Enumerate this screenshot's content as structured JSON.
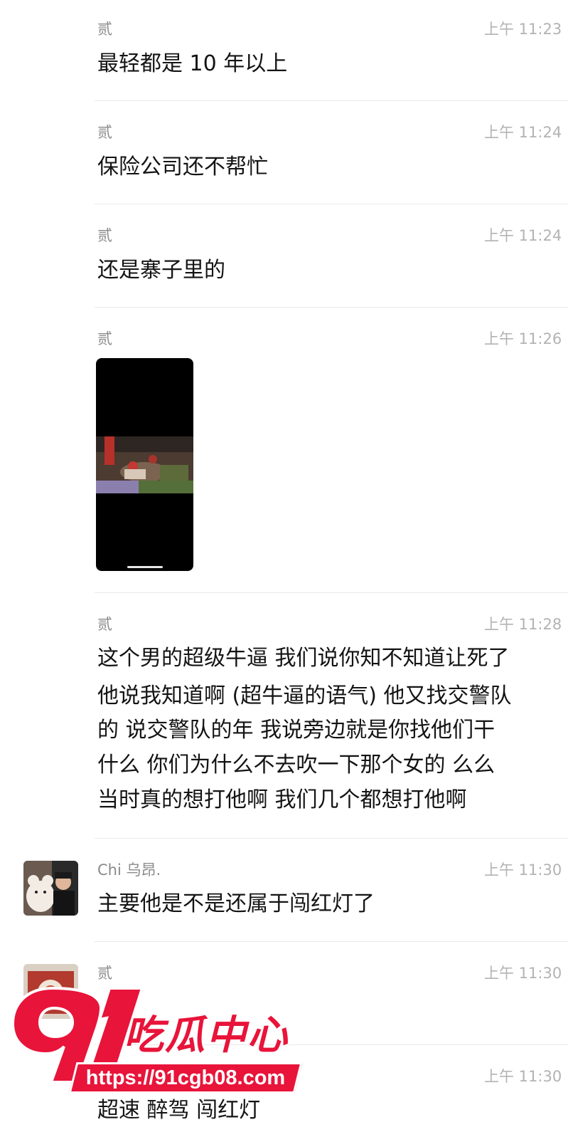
{
  "messages": [
    {
      "sender": "贰",
      "time": "上午 11:23",
      "text": "最轻都是 10 年以上"
    },
    {
      "sender": "贰",
      "time": "上午 11:24",
      "text": "保险公司还不帮忙"
    },
    {
      "sender": "贰",
      "time": "上午 11:24",
      "text": "还是寨子里的"
    },
    {
      "sender": "贰",
      "time": "上午 11:26",
      "text": ""
    },
    {
      "sender": "贰",
      "time": "上午 11:28",
      "lines": [
        "这个男的超级牛逼 我们说你知不知道让死了",
        "他说我知道啊 (超牛逼的语气) 他又找交警队",
        "的 说交警队的年 我说旁边就是你找他们干",
        "什么 你们为什么不去吹一下那个女的 么么",
        "当时真的想打他啊 我们几个都想打他啊"
      ]
    },
    {
      "sender": "Chi 乌昂.",
      "time": "上午 11:30",
      "text": "主要他是不是还属于闯红灯了"
    },
    {
      "sender": "贰",
      "time": "上午 11:30",
      "text": ""
    },
    {
      "sender": "",
      "time": "上午 11:30",
      "text": "超速 醉驾 闯红灯"
    }
  ],
  "watermark": {
    "number": "91",
    "name": "吃瓜中心",
    "url": "https://91cgb08.com"
  },
  "colors": {
    "watermark_red": "#e8143a",
    "time_gray": "#b3b3b3",
    "sender_gray": "#8a8a8a"
  }
}
